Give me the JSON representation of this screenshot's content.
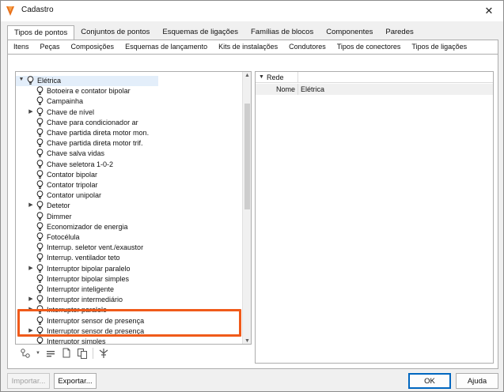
{
  "window": {
    "title": "Cadastro",
    "close": "✕"
  },
  "tabs_primary": [
    "Tipos de pontos",
    "Conjuntos de pontos",
    "Esquemas de ligações",
    "Famílias de blocos",
    "Componentes",
    "Paredes"
  ],
  "tabs_secondary": [
    "Itens",
    "Peças",
    "Composições",
    "Esquemas de lançamento",
    "Kits de instalações",
    "Condutores",
    "Tipos de conectores",
    "Tipos de ligações"
  ],
  "tree": {
    "root": "Elétrica",
    "items": [
      {
        "label": "Botoeira e contator bipolar",
        "expandable": false
      },
      {
        "label": "Campainha",
        "expandable": false
      },
      {
        "label": "Chave de nível",
        "expandable": true
      },
      {
        "label": "Chave para condicionador ar",
        "expandable": false
      },
      {
        "label": "Chave partida direta motor mon.",
        "expandable": false
      },
      {
        "label": "Chave partida direta motor trif.",
        "expandable": false
      },
      {
        "label": "Chave salva vidas",
        "expandable": false
      },
      {
        "label": "Chave seletora 1-0-2",
        "expandable": false
      },
      {
        "label": "Contator bipolar",
        "expandable": false
      },
      {
        "label": "Contator tripolar",
        "expandable": false
      },
      {
        "label": "Contator unipolar",
        "expandable": false
      },
      {
        "label": "Detetor",
        "expandable": true
      },
      {
        "label": "Dimmer",
        "expandable": false
      },
      {
        "label": "Economizador de energia",
        "expandable": false
      },
      {
        "label": "Fotocélula",
        "expandable": false
      },
      {
        "label": "Interrup. seletor vent./exaustor",
        "expandable": false
      },
      {
        "label": "Interrup. ventilador teto",
        "expandable": false
      },
      {
        "label": "Interruptor bipolar paralelo",
        "expandable": true
      },
      {
        "label": "Interruptor bipolar simples",
        "expandable": false
      },
      {
        "label": "Interruptor inteligente",
        "expandable": false
      },
      {
        "label": "Interruptor intermediário",
        "expandable": true
      },
      {
        "label": "Interruptor paralelo",
        "expandable": true
      },
      {
        "label": "Interruptor sensor de presença",
        "expandable": false
      },
      {
        "label": "Interruptor sensor de presença",
        "expandable": true
      },
      {
        "label": "Interruptor simples",
        "expandable": false
      }
    ]
  },
  "properties": {
    "group": "Rede",
    "rows": [
      {
        "key": "Nome",
        "value": "Elétrica"
      }
    ]
  },
  "buttons": {
    "import": "Importar...",
    "export": "Exportar...",
    "ok": "OK",
    "help": "Ajuda"
  },
  "colors": {
    "highlight": "#f05a1a",
    "selection": "#e3eefa"
  }
}
